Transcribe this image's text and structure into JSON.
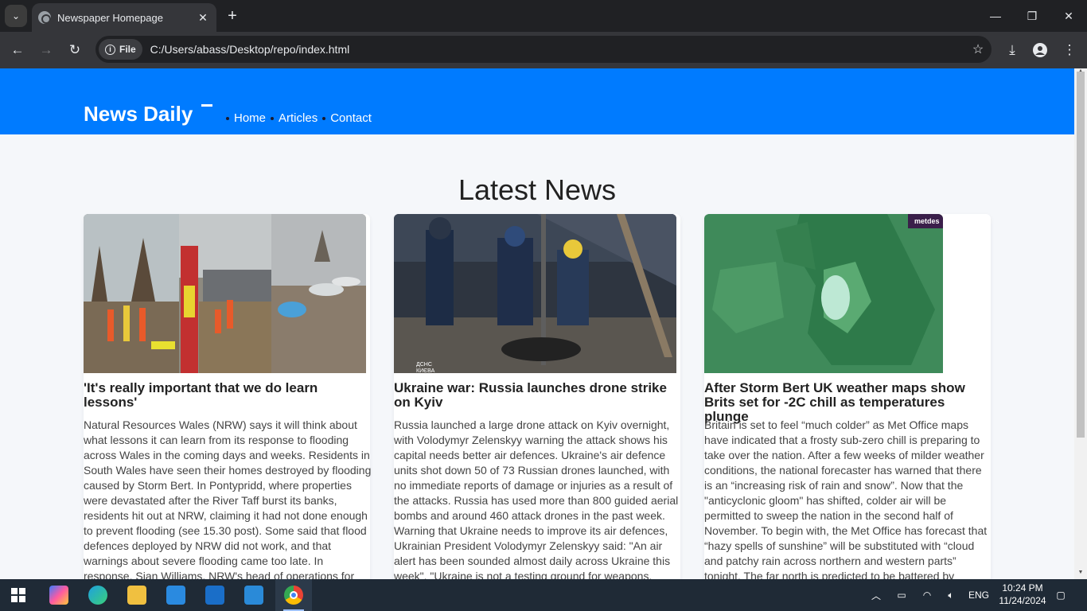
{
  "browser": {
    "tab_title": "Newspaper Homepage",
    "new_tab_symbol": "+",
    "chip_label": "File",
    "url": "C:/Users/abass/Desktop/repo/index.html"
  },
  "site": {
    "logo": "News Daily",
    "nav": [
      "Home",
      "Articles",
      "Contact"
    ],
    "section_title": "Latest News"
  },
  "articles": [
    {
      "title": "'It's really important that we do learn lessons'",
      "body": "Natural Resources Wales (NRW) says it will think about what lessons it can learn from its response to flooding across Wales in the coming days and weeks. Residents in South Wales have seen their homes destroyed by flooding caused by Storm Bert. In Pontypridd, where properties were devastated after the River Taff burst its banks, residents hit out at NRW, claiming it had not done enough to prevent flooding (see 15.30 post). Some said that flood defences deployed by NRW did not work, and that warnings about severe flooding came too late. In response, Sian Williams, NRW's head of operations for northwest Wales, says its",
      "image_icon": "flood-photo"
    },
    {
      "title": "Ukraine war: Russia launches drone strike on Kyiv",
      "body": "Russia launched a large drone attack on Kyiv overnight, with Volodymyr Zelenskyy warning the attack shows his capital needs better air defences. Ukraine's air defence units shot down 50 of 73 Russian drones launched, with no immediate reports of damage or injuries as a result of the attacks. Russia has used more than 800 guided aerial bombs and around 460 attack drones in the past week. Warning that Ukraine needs to improve its air defences, Ukrainian President Volodymyr Zelenskyy said: \"An air alert has been sounded almost daily across Ukraine this week\". \"Ukraine is not a testing ground for weapons. Ukraine is a sovereign and",
      "image_icon": "rescue-photo",
      "image_caption": "ДСНС КИЄВА"
    },
    {
      "title": "After Storm Bert UK weather maps show Brits set for -2C chill as temperatures plunge",
      "body": "Britain is set to feel “much colder” as Met Office maps have indicated that a frosty sub-zero chill is preparing to take over the nation. After a few weeks of milder weather conditions, the national forecaster has warned that there is an “increasing risk of rain and snow”. Now that the \"anticyclonic gloom\" has shifted, colder air will be permitted to sweep the nation in the second half of November. To begin with, the Met Office has forecast that “hazy spells of sunshine” will be substituted with “cloud and patchy rain across northern and western parts” tonight. The far north is predicted to be battered by “scattered wintry blustery showers” and will settle",
      "image_icon": "weather-map",
      "image_badge": "metdes"
    }
  ],
  "taskbar": {
    "lang": "ENG",
    "time": "10:24 PM",
    "date": "11/24/2024"
  },
  "colors": {
    "header_blue": "#007bff",
    "page_bg": "#f5f7fa"
  }
}
